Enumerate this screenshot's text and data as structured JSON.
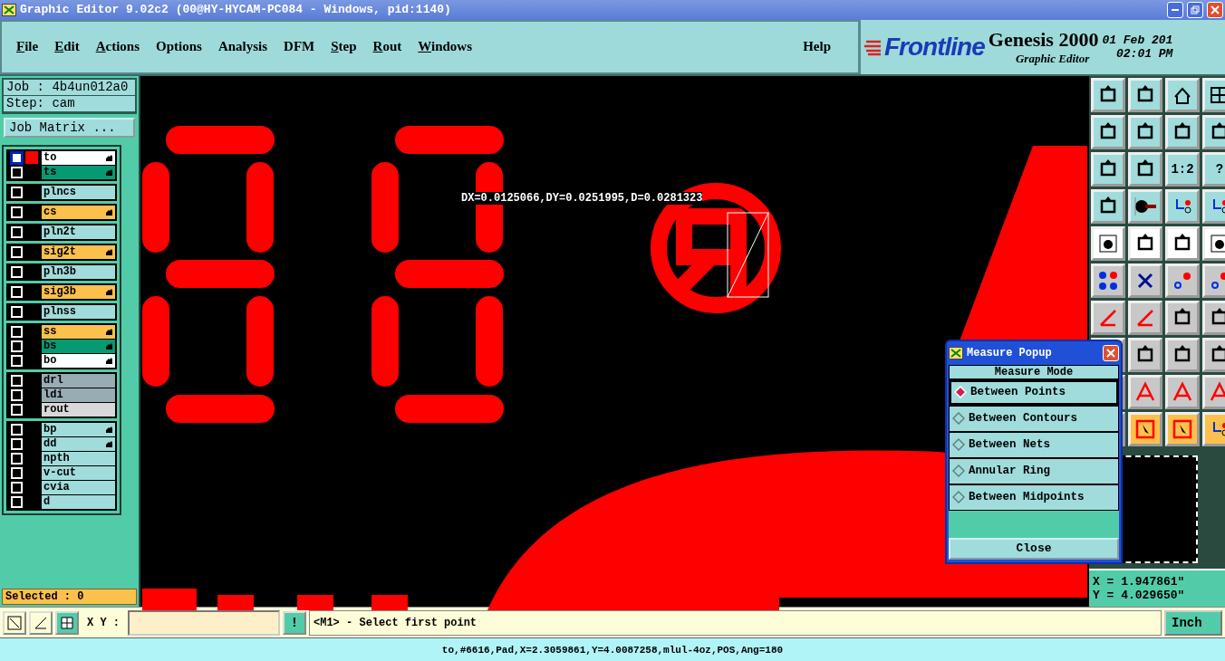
{
  "window": {
    "title": "Graphic Editor 9.02c2 (00@HY-HYCAM-PC084 - Windows, pid:1140)"
  },
  "menu": [
    {
      "label": "File",
      "underline_first": true
    },
    {
      "label": "Edit",
      "underline_first": true
    },
    {
      "label": "Actions",
      "underline_first": true
    },
    {
      "label": "Options",
      "underline_first": false
    },
    {
      "label": "Analysis",
      "underline_first": false
    },
    {
      "label": "DFM",
      "underline_first": false
    },
    {
      "label": "Step",
      "underline_first": true
    },
    {
      "label": "Rout",
      "underline_first": true
    },
    {
      "label": "Windows",
      "underline_first": true
    }
  ],
  "help": "Help",
  "brand": {
    "logo": "Frontline",
    "product": "Genesis 2000",
    "subtitle": "Graphic Editor",
    "date": "01 Feb 201",
    "time": "02:01 PM"
  },
  "job": {
    "job": "Job : 4b4un012a0",
    "step": "Step: cam",
    "matrix_button": "Job Matrix ..."
  },
  "layer_groups": [
    [
      {
        "name": "to",
        "color": "#ffffff",
        "editable": true,
        "work_layer": true,
        "checked": false
      },
      {
        "name": "ts",
        "color": "#069a72",
        "editable": true,
        "work_layer": false,
        "checked": false
      }
    ],
    [
      {
        "name": "plncs",
        "color": "#a0dcdc",
        "editable": false,
        "work_layer": false,
        "checked": false
      }
    ],
    [
      {
        "name": "cs",
        "color": "#fcc04c",
        "editable": true,
        "work_layer": false,
        "checked": false
      }
    ],
    [
      {
        "name": "pln2t",
        "color": "#a0dcdc",
        "editable": false,
        "work_layer": false,
        "checked": false
      }
    ],
    [
      {
        "name": "sig2t",
        "color": "#fcc04c",
        "editable": true,
        "work_layer": false,
        "checked": false
      }
    ],
    [
      {
        "name": "pln3b",
        "color": "#a0dcdc",
        "editable": false,
        "work_layer": false,
        "checked": false
      }
    ],
    [
      {
        "name": "sig3b",
        "color": "#fcc04c",
        "editable": true,
        "work_layer": false,
        "checked": false
      }
    ],
    [
      {
        "name": "plnss",
        "color": "#a0dcdc",
        "editable": false,
        "work_layer": false,
        "checked": false
      }
    ],
    [
      {
        "name": "ss",
        "color": "#fcc04c",
        "editable": true,
        "work_layer": false,
        "checked": false
      },
      {
        "name": "bs",
        "color": "#069a72",
        "editable": true,
        "work_layer": false,
        "checked": false
      },
      {
        "name": "bo",
        "color": "#ffffff",
        "editable": true,
        "work_layer": false,
        "checked": false
      }
    ],
    [
      {
        "name": "drl",
        "color": "#98acb4",
        "editable": false,
        "work_layer": false,
        "checked": false
      },
      {
        "name": "ldi",
        "color": "#98acb4",
        "editable": false,
        "work_layer": false,
        "checked": false
      },
      {
        "name": "rout",
        "color": "#d8d8d8",
        "editable": false,
        "work_layer": false,
        "checked": false
      }
    ],
    [
      {
        "name": "bp",
        "color": "#a0dcdc",
        "editable": true,
        "work_layer": false,
        "checked": false
      },
      {
        "name": "dd",
        "color": "#a0dcdc",
        "editable": true,
        "work_layer": false,
        "checked": false
      },
      {
        "name": "npth",
        "color": "#a0dcdc",
        "editable": false,
        "work_layer": false,
        "checked": false
      },
      {
        "name": "v-cut",
        "color": "#a0dcdc",
        "editable": false,
        "work_layer": false,
        "checked": false
      },
      {
        "name": "cvia",
        "color": "#a0dcdc",
        "editable": false,
        "work_layer": false,
        "checked": false
      },
      {
        "name": "d",
        "color": "#a0dcdc",
        "editable": false,
        "work_layer": false,
        "checked": false
      }
    ]
  ],
  "selected_count": "Selected : 0",
  "measure_text": "DX=0.0125066,DY=0.0251995,D=0.0281323",
  "tool_buttons": [
    {
      "kind": "icon"
    },
    {
      "kind": "icon"
    },
    {
      "kind": "icon"
    },
    {
      "kind": "icon"
    },
    {
      "kind": "icon"
    },
    {
      "kind": "icon"
    },
    {
      "kind": "icon"
    },
    {
      "kind": "icon"
    },
    {
      "kind": "icon"
    },
    {
      "kind": "icon"
    },
    {
      "kind": "text",
      "label": "1:2"
    },
    {
      "kind": "text",
      "label": "?"
    },
    {
      "kind": "icon"
    },
    {
      "kind": "icon"
    },
    {
      "kind": "icon"
    },
    {
      "kind": "icon"
    },
    {
      "kind": "icon"
    },
    {
      "kind": "icon"
    },
    {
      "kind": "icon"
    },
    {
      "kind": "icon"
    },
    {
      "kind": "icon"
    },
    {
      "kind": "icon"
    },
    {
      "kind": "icon"
    },
    {
      "kind": "icon"
    },
    {
      "kind": "icon"
    },
    {
      "kind": "icon"
    },
    {
      "kind": "icon"
    },
    {
      "kind": "icon"
    },
    {
      "kind": "icon"
    },
    {
      "kind": "icon"
    },
    {
      "kind": "icon"
    },
    {
      "kind": "icon"
    },
    {
      "kind": "icon"
    },
    {
      "kind": "icon"
    },
    {
      "kind": "icon"
    },
    {
      "kind": "icon"
    },
    {
      "kind": "icon"
    },
    {
      "kind": "icon"
    },
    {
      "kind": "icon"
    },
    {
      "kind": "icon"
    }
  ],
  "coordinates": {
    "x": "X = 1.947861\"",
    "y": "Y = 4.029650\""
  },
  "measure_popup": {
    "title": "Measure Popup",
    "heading": "Measure Mode",
    "options": [
      {
        "label": "Between Points",
        "selected": true
      },
      {
        "label": "Between Contours",
        "selected": false
      },
      {
        "label": "Between Nets",
        "selected": false
      },
      {
        "label": "Annular Ring",
        "selected": false
      },
      {
        "label": "Between Midpoints",
        "selected": false
      }
    ],
    "close": "Close"
  },
  "command_bar": {
    "xy_label": "X Y :",
    "bang": "!",
    "message": "<M1> - Select first point",
    "units": "Inch"
  },
  "status_bar": "to,#6616,Pad,X=2.3059861,Y=4.0087258,mlul-4oz,POS,Ang=180"
}
